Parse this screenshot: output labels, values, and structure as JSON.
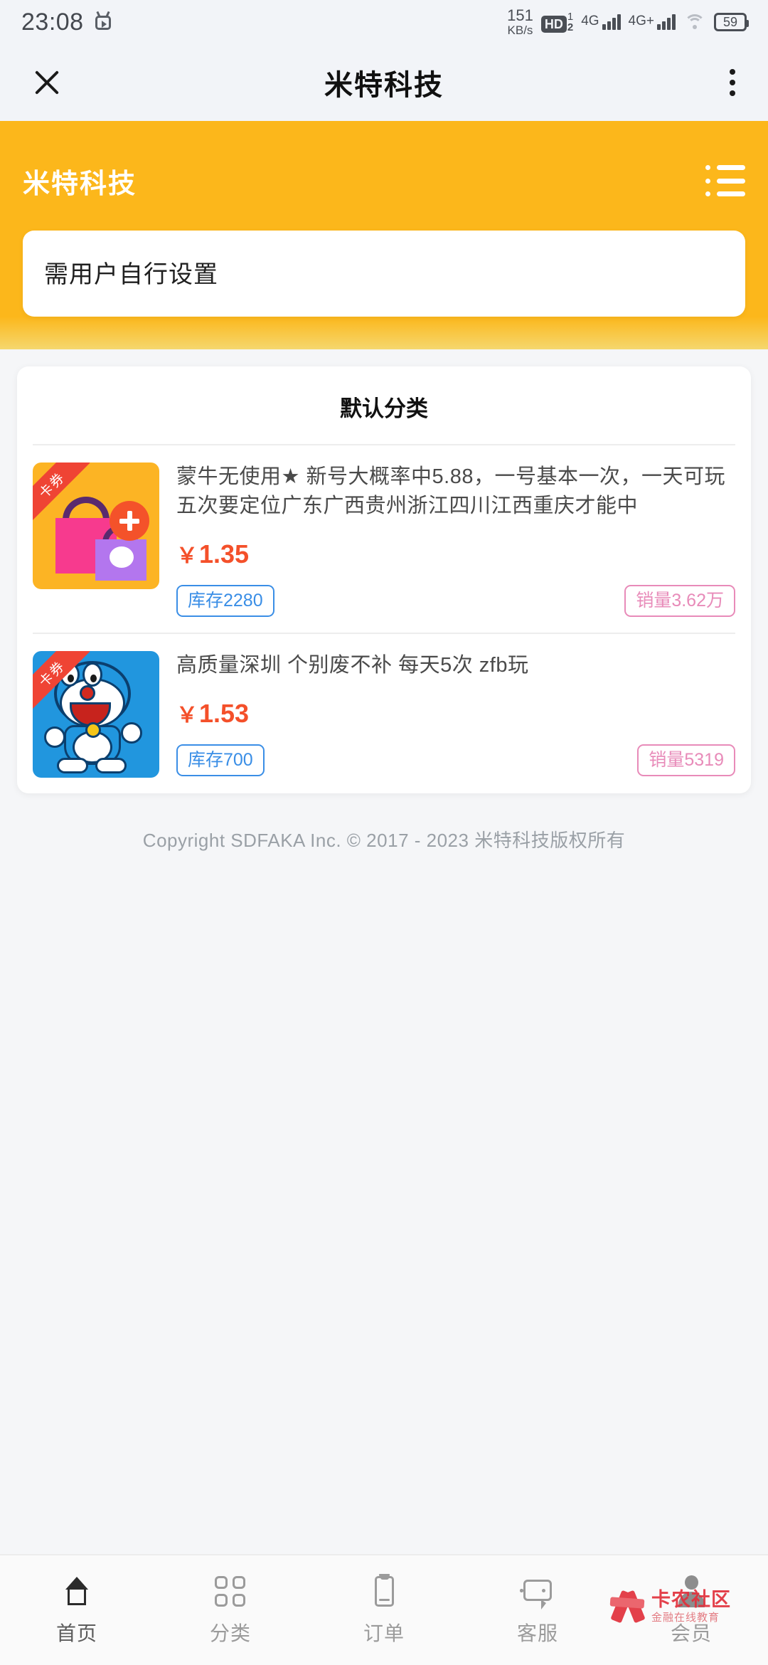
{
  "status_bar": {
    "time": "23:08",
    "alarm_icon": "alarm-clock-icon",
    "net_speed_value": "151",
    "net_speed_unit": "KB/s",
    "hd_label": "HD",
    "hd_sim_top": "1",
    "hd_sim_bottom": "2",
    "signal_1_label": "4G",
    "signal_2_label": "4G+",
    "wifi_icon": "wifi-icon",
    "battery_level": "59"
  },
  "app_bar": {
    "close_icon": "close-icon",
    "title": "米特科技",
    "more_icon": "more-vertical-icon"
  },
  "hero": {
    "shop_name": "米特科技",
    "menu_icon": "list-menu-icon",
    "notice_text": "需用户自行设置",
    "background_color": "#fcb71b"
  },
  "category_card": {
    "title": "默认分类",
    "products": [
      {
        "ribbon_label": "卡券",
        "thumb_icon": "shopping-bag-plus-icon",
        "name": "蒙牛无使用★ 新号大概率中5.88，一号基本一次，一天可玩五次要定位广东广西贵州浙江四川江西重庆才能中",
        "currency": "￥",
        "price": "1.35",
        "stock_badge": "库存2280",
        "sales_badge": "销量3.62万"
      },
      {
        "ribbon_label": "卡券",
        "thumb_icon": "doraemon-icon",
        "name": "高质量深圳 个别废不补 每天5次 zfb玩",
        "currency": "￥",
        "price": "1.53",
        "stock_badge": "库存700",
        "sales_badge": "销量5319"
      }
    ]
  },
  "footer": {
    "copyright": "Copyright SDFAKA Inc. © 2017 - 2023 米特科技版权所有"
  },
  "tab_bar": {
    "items": [
      {
        "label": "首页",
        "icon": "home-icon",
        "active": true
      },
      {
        "label": "分类",
        "icon": "grid-icon",
        "active": false
      },
      {
        "label": "订单",
        "icon": "clipboard-icon",
        "active": false
      },
      {
        "label": "客服",
        "icon": "chat-bubble-icon",
        "active": false
      },
      {
        "label": "会员",
        "icon": "user-icon",
        "active": false
      }
    ]
  },
  "watermark": {
    "main_text": "卡农社区",
    "sub_text": "金融在线教育",
    "color": "#e2313c"
  },
  "colors": {
    "brand_orange": "#fcb71b",
    "price_red": "#f4502a",
    "stock_blue": "#3a8ee6",
    "sales_pink": "#e88bb9",
    "page_bg": "#f5f6f8"
  }
}
